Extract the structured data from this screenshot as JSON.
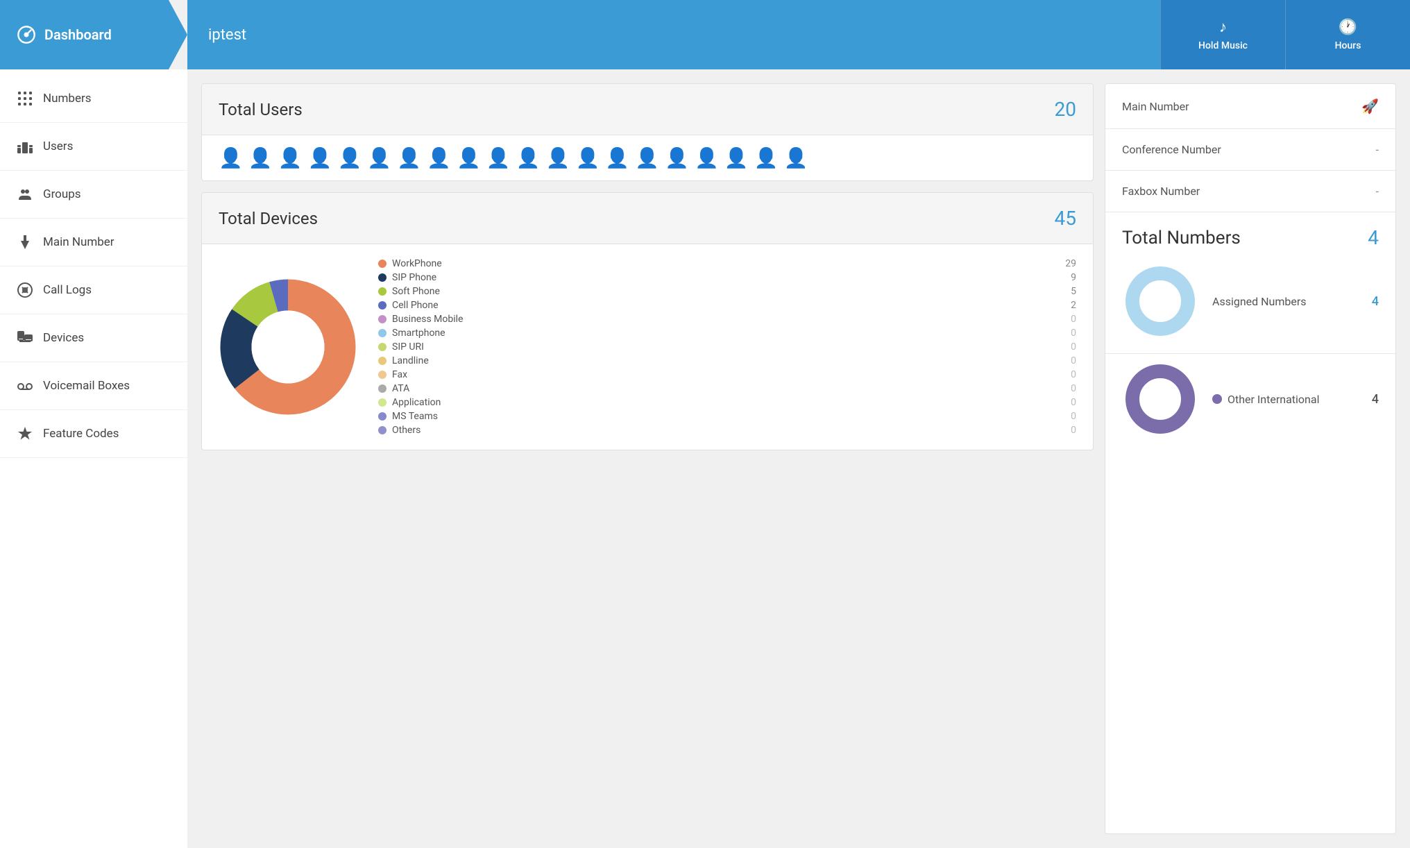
{
  "nav": {
    "dashboard_label": "Dashboard",
    "title": "iptest",
    "hold_music_label": "Hold Music",
    "hours_label": "Hours"
  },
  "sidebar": {
    "items": [
      {
        "id": "numbers",
        "label": "Numbers"
      },
      {
        "id": "users",
        "label": "Users"
      },
      {
        "id": "groups",
        "label": "Groups"
      },
      {
        "id": "main-number",
        "label": "Main Number"
      },
      {
        "id": "call-logs",
        "label": "Call Logs"
      },
      {
        "id": "devices",
        "label": "Devices"
      },
      {
        "id": "voicemail-boxes",
        "label": "Voicemail Boxes"
      },
      {
        "id": "feature-codes",
        "label": "Feature Codes"
      }
    ]
  },
  "total_users": {
    "title": "Total Users",
    "count": 20,
    "icon_count": 20
  },
  "total_devices": {
    "title": "Total Devices",
    "count": 45,
    "chart": {
      "items": [
        {
          "label": "WorkPhone",
          "count": 29,
          "color": "#e8855a",
          "zero": false
        },
        {
          "label": "SIP Phone",
          "count": 9,
          "color": "#1e3a5f",
          "zero": false
        },
        {
          "label": "Soft Phone",
          "count": 5,
          "color": "#a8c840",
          "zero": false
        },
        {
          "label": "Cell Phone",
          "count": 2,
          "color": "#5b6bc0",
          "zero": false
        },
        {
          "label": "Business Mobile",
          "count": 0,
          "color": "#c490c8",
          "zero": true
        },
        {
          "label": "Smartphone",
          "count": 0,
          "color": "#90c8e8",
          "zero": true
        },
        {
          "label": "SIP URI",
          "count": 0,
          "color": "#c8d870",
          "zero": true
        },
        {
          "label": "Landline",
          "count": 0,
          "color": "#e8c87a",
          "zero": true
        },
        {
          "label": "Fax",
          "count": 0,
          "color": "#f0c890",
          "zero": true
        },
        {
          "label": "ATA",
          "count": 0,
          "color": "#aaaaaa",
          "zero": true
        },
        {
          "label": "Application",
          "count": 0,
          "color": "#d0e890",
          "zero": true
        },
        {
          "label": "MS Teams",
          "count": 0,
          "color": "#8888cc",
          "zero": true
        },
        {
          "label": "Others",
          "count": 0,
          "color": "#9090cc",
          "zero": true
        }
      ]
    }
  },
  "right_panel": {
    "main_number_label": "Main Number",
    "conference_number_label": "Conference Number",
    "conference_number_value": "-",
    "faxbox_number_label": "Faxbox Number",
    "faxbox_number_value": "-",
    "total_numbers_title": "Total Numbers",
    "total_numbers_count": "4",
    "assigned_numbers_label": "Assigned Numbers",
    "assigned_numbers_count": "4",
    "other_intl_label": "Other International",
    "other_intl_count": "4"
  }
}
